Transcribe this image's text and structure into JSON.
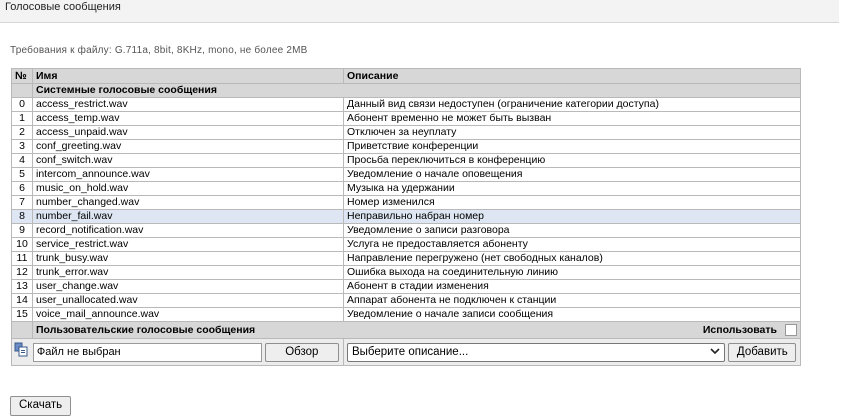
{
  "header": {
    "title": "Голосовые сообщения"
  },
  "requirements": "Требования к файлу: G.711a, 8bit, 8KHz, mono, не более 2MB",
  "table": {
    "columns": {
      "num": "№",
      "name": "Имя",
      "description": "Описание"
    },
    "system_section_label": "Системные голосовые сообщения",
    "rows": [
      {
        "num": "0",
        "name": "access_restrict.wav",
        "description": "Данный вид связи недоступен (ограничение категории доступа)"
      },
      {
        "num": "1",
        "name": "access_temp.wav",
        "description": "Абонент временно не может быть вызван"
      },
      {
        "num": "2",
        "name": "access_unpaid.wav",
        "description": "Отключен за неуплату"
      },
      {
        "num": "3",
        "name": "conf_greeting.wav",
        "description": "Приветствие конференции"
      },
      {
        "num": "4",
        "name": "conf_switch.wav",
        "description": "Просьба переключиться в конференцию"
      },
      {
        "num": "5",
        "name": "intercom_announce.wav",
        "description": "Уведомление о начале оповещения"
      },
      {
        "num": "6",
        "name": "music_on_hold.wav",
        "description": "Музыка на удержании"
      },
      {
        "num": "7",
        "name": "number_changed.wav",
        "description": "Номер изменился"
      },
      {
        "num": "8",
        "name": "number_fail.wav",
        "description": "Неправильно набран номер"
      },
      {
        "num": "9",
        "name": "record_notification.wav",
        "description": "Уведомление о записи разговора"
      },
      {
        "num": "10",
        "name": "service_restrict.wav",
        "description": "Услуга не предоставляется абоненту"
      },
      {
        "num": "11",
        "name": "trunk_busy.wav",
        "description": "Направление перегружено (нет свободных каналов)"
      },
      {
        "num": "12",
        "name": "trunk_error.wav",
        "description": "Ошибка выхода на соединительную линию"
      },
      {
        "num": "13",
        "name": "user_change.wav",
        "description": "Абонент в стадии изменения"
      },
      {
        "num": "14",
        "name": "user_unallocated.wav",
        "description": "Аппарат абонента не подключен к станции"
      },
      {
        "num": "15",
        "name": "voice_mail_announce.wav",
        "description": "Уведомление о начале записи сообщения"
      }
    ],
    "highlighted_row": "8",
    "user_section_label": "Пользовательские голосовые сообщения",
    "use_label": "Использовать"
  },
  "upload": {
    "file_value": "Файл не выбран",
    "browse_label": "Обзор",
    "select_value": "Выберите описание...",
    "add_label": "Добавить"
  },
  "download_label": "Скачать",
  "colors": {
    "header_bg": "#f3f3f3",
    "table_header_bg": "#d7d7d7",
    "highlight_row_bg": "#dde6f2",
    "border": "#b9b9b9"
  },
  "icons": {
    "upload": "add-file-icon",
    "select": "chevron-down-icon"
  }
}
